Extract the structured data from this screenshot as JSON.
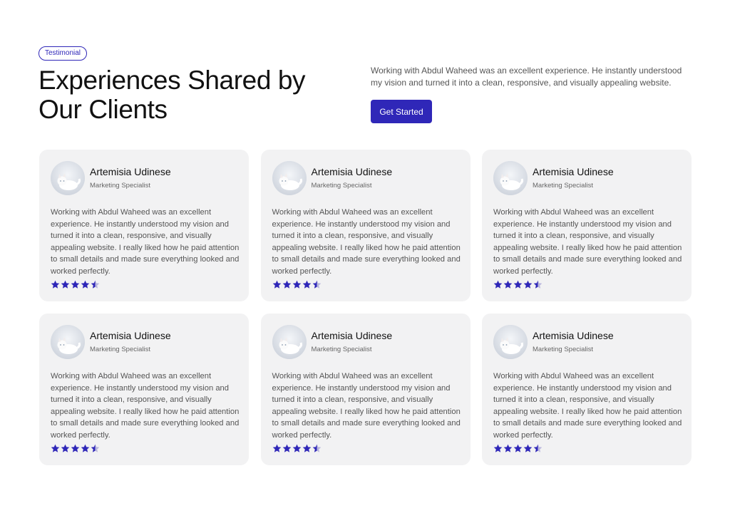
{
  "badge": "Testimonial",
  "title": "Experiences Shared by Our Clients",
  "intro": "Working with Abdul Waheed was an excellent experience. He instantly understood my vision and turned it into a clean, responsive, and visually appealing website.",
  "cta_label": "Get Started",
  "colors": {
    "accent": "#2f27b8",
    "card_bg": "#f2f2f3"
  },
  "testimonials": [
    {
      "name": "Artemisia Udinese",
      "role": "Marketing Specialist",
      "quote": "Working with Abdul Waheed was an excellent experience. He instantly understood my vision and turned it into a clean, responsive, and visually appealing website. I really liked how he paid attention to small details and made sure everything looked and worked perfectly.",
      "rating": 4.5
    },
    {
      "name": "Artemisia Udinese",
      "role": "Marketing Specialist",
      "quote": "Working with Abdul Waheed was an excellent experience. He instantly understood my vision and turned it into a clean, responsive, and visually appealing website. I really liked how he paid attention to small details and made sure everything looked and worked perfectly.",
      "rating": 4.5
    },
    {
      "name": "Artemisia Udinese",
      "role": "Marketing Specialist",
      "quote": "Working with Abdul Waheed was an excellent experience. He instantly understood my vision and turned it into a clean, responsive, and visually appealing website. I really liked how he paid attention to small details and made sure everything looked and worked perfectly.",
      "rating": 4.5
    },
    {
      "name": "Artemisia Udinese",
      "role": "Marketing Specialist",
      "quote": "Working with Abdul Waheed was an excellent experience. He instantly understood my vision and turned it into a clean, responsive, and visually appealing website. I really liked how he paid attention to small details and made sure everything looked and worked perfectly.",
      "rating": 4.5
    },
    {
      "name": "Artemisia Udinese",
      "role": "Marketing Specialist",
      "quote": "Working with Abdul Waheed was an excellent experience. He instantly understood my vision and turned it into a clean, responsive, and visually appealing website. I really liked how he paid attention to small details and made sure everything looked and worked perfectly.",
      "rating": 4.5
    },
    {
      "name": "Artemisia Udinese",
      "role": "Marketing Specialist",
      "quote": "Working with Abdul Waheed was an excellent experience. He instantly understood my vision and turned it into a clean, responsive, and visually appealing website. I really liked how he paid attention to small details and made sure everything looked and worked perfectly.",
      "rating": 4.5
    }
  ]
}
